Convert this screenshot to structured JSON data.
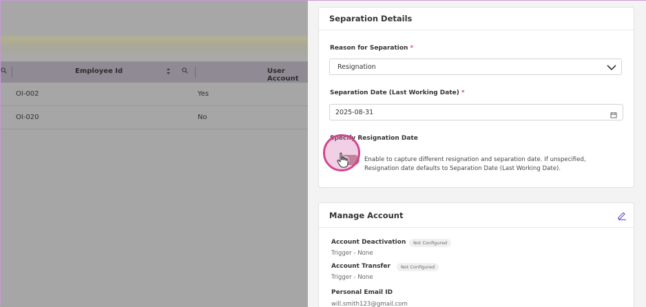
{
  "table": {
    "col_employee_id": "Employee Id",
    "col_user_account": "User Account",
    "rows": [
      {
        "employee_id": "OI-002",
        "user_account": "Yes"
      },
      {
        "employee_id": "OI-020",
        "user_account": "No"
      }
    ]
  },
  "separation": {
    "title": "Separation Details",
    "reason_label": "Reason for Separation",
    "reason_value": "Resignation",
    "date_label": "Separation Date (Last Working Date)",
    "date_value": "2025-08-31",
    "required_marker": "*",
    "resignation_toggle_label": "Specify Resignation Date",
    "resignation_toggle_desc": "Enable to capture different resignation and separation date. If unspecified, Resignation date defaults to Separation Date (Last Working Date).",
    "toggle_on": false
  },
  "manage_account": {
    "title": "Manage Account",
    "deactivation_label": "Account Deactivation",
    "deactivation_status": "Not Configured",
    "deactivation_trigger": "Trigger - None",
    "transfer_label": "Account Transfer",
    "transfer_status": "Not Configured",
    "transfer_trigger": "Trigger - None",
    "personal_email_label": "Personal Email ID",
    "personal_email_value": "will.smith123@gmail.com"
  },
  "icons": [
    "search-icon",
    "sort-icon",
    "chevron-down-icon",
    "calendar-icon",
    "edit-icon",
    "hand-pointer-icon"
  ],
  "colors": {
    "required": "#e5484d",
    "toggle_track": "#b8868d",
    "highlight_ring": "#d4458c",
    "edit_icon": "#6a5acd"
  }
}
